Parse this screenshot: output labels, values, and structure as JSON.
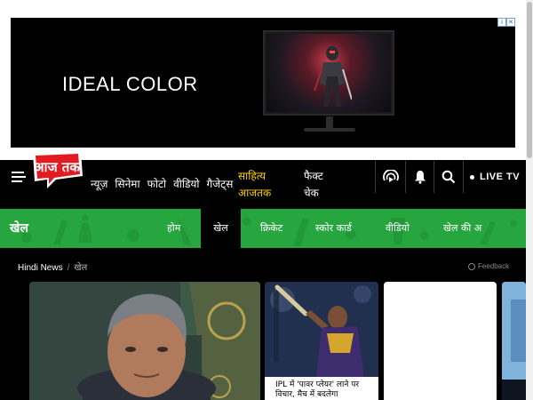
{
  "ad": {
    "headline": "IDEAL COLOR",
    "info_icon": "info-icon",
    "close_icon": "close-icon"
  },
  "header": {
    "menu_icon": "hamburger-icon",
    "logo_text": "आज तक",
    "nav": [
      "न्यूज़",
      "सिनेमा",
      "फोटो",
      "वीडियो",
      "गैजेट्स"
    ],
    "sahitya": [
      "साहित्य",
      "आजतक"
    ],
    "fact_check": [
      "फैक्ट",
      "चेक"
    ],
    "live_label": "LIVE TV",
    "accent_color": "#ffd200",
    "brand_color": "#e21b22"
  },
  "sport": {
    "title": "खेल",
    "nav": [
      {
        "label": "होम",
        "active": false
      },
      {
        "label": "खेल",
        "active": true
      },
      {
        "label": "क्रिकेट",
        "active": false
      },
      {
        "label": "स्कोर कार्ड",
        "active": false
      },
      {
        "label": "वीडियो",
        "active": false
      },
      {
        "label": "खेल की अ",
        "active": false
      }
    ],
    "bar_color": "#27a640"
  },
  "breadcrumb": {
    "home": "Hindi News",
    "separator": "/",
    "current": "खेल"
  },
  "feedback": "Feedback",
  "cards": {
    "ipl_caption": [
      "IPL में 'पावर प्लेयर' लाने पर",
      "विचार, मैच में बदलेगा"
    ]
  }
}
